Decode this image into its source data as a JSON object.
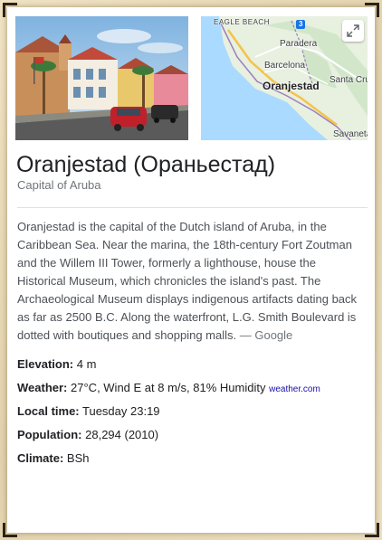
{
  "panel": {
    "title": "Oranjestad (Ораньестад)",
    "subtitle": "Capital of Aruba",
    "description": "Oranjestad is the capital of the Dutch island of Aruba, in the Caribbean Sea. Near the marina, the 18th-century Fort Zoutman and the Willem III Tower, formerly a lighthouse, house the Historical Museum, which chronicles the island's past. The Archaeological Museum displays indigenous artifacts dating back as far as 2500 B.C. Along the waterfront, L.G. Smith Boulevard is dotted with boutiques and shopping malls.",
    "description_source": "— Google"
  },
  "map": {
    "labels": {
      "eagle_beach": "EAGLE BEACH",
      "paradera": "Paradera",
      "barcelona": "Barcelona",
      "oranjestad": "Oranjestad",
      "santa_cruz": "Santa Cruz",
      "savaneta": "Savaneta"
    },
    "route_badge": "3"
  },
  "facts": {
    "elevation": {
      "label": "Elevation:",
      "value": "4 m"
    },
    "weather": {
      "label": "Weather:",
      "value": "27°C, Wind E at 8 m/s, 81% Humidity",
      "source": "weather.com"
    },
    "local_time": {
      "label": "Local time:",
      "value": "Tuesday 23:19"
    },
    "population": {
      "label": "Population:",
      "value": "28,294 (2010)"
    },
    "climate": {
      "label": "Climate:",
      "value": "BSh"
    }
  },
  "colors": {
    "title": "#202124",
    "text": "#4d5156",
    "muted": "#70757a",
    "link": "#1a0dab",
    "frame": "#e6d9b8"
  }
}
